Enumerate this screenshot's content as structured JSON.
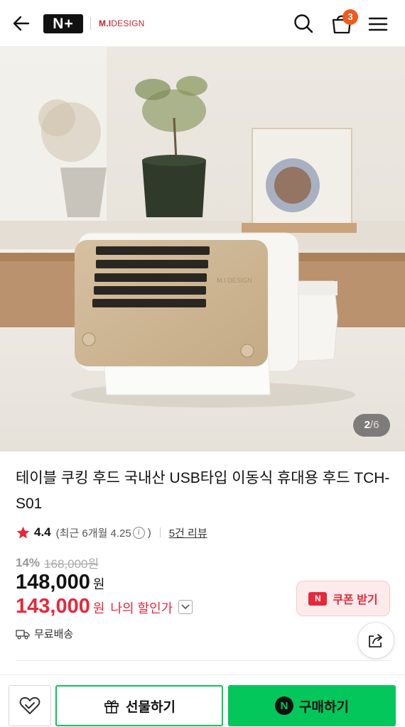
{
  "header": {
    "logo_text": "N+",
    "brand_bold": "M.I",
    "brand_rest": "DESIGN",
    "cart_count": "3"
  },
  "hero": {
    "image_label": "M.I DESIGN",
    "current_page": "2",
    "separator": "/",
    "total_pages": "6"
  },
  "product": {
    "title": "테이블 쿠킹 후드 국내산 USB타입 이동식 휴대용 후드 TCH-S01",
    "rating": "4.4",
    "recent_open": "(최근 6개월 4.25",
    "recent_close": ")",
    "info_icon": "i",
    "review_link": "5건 리뷰",
    "discount_rate": "14%",
    "original_price": "168,000원",
    "price": "148,000",
    "price_unit": "원",
    "my_price": "143,000",
    "my_price_unit": "원",
    "my_price_label": "나의 할인가",
    "shipping": "무료배송"
  },
  "coupon": {
    "icon_text": "N",
    "label": "쿠폰 받기"
  },
  "bottom_bar": {
    "gift_label": "선물하기",
    "npay_icon_text": "N",
    "buy_label": "구매하기"
  },
  "colors": {
    "accent_green": "#03c75a",
    "sale_red": "#e6283a",
    "cart_badge": "#f05a1b"
  }
}
